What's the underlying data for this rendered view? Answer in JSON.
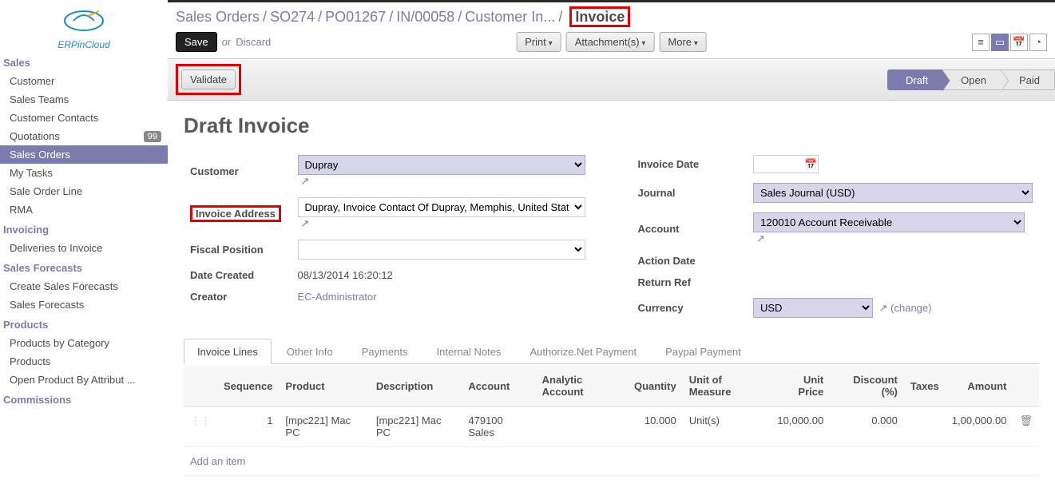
{
  "logo_text": "ERPinCloud",
  "sidebar": {
    "groups": [
      {
        "header": "Sales",
        "items": [
          {
            "label": "Customer"
          },
          {
            "label": "Sales Teams"
          },
          {
            "label": "Customer Contacts"
          },
          {
            "label": "Quotations",
            "badge": "99"
          },
          {
            "label": "Sales Orders",
            "active": true
          },
          {
            "label": "My Tasks"
          },
          {
            "label": "Sale Order Line"
          },
          {
            "label": "RMA"
          }
        ]
      },
      {
        "header": "Invoicing",
        "items": [
          {
            "label": "Deliveries to Invoice"
          }
        ]
      },
      {
        "header": "Sales Forecasts",
        "items": [
          {
            "label": "Create Sales Forecasts"
          },
          {
            "label": "Sales Forecasts"
          }
        ]
      },
      {
        "header": "Products",
        "items": [
          {
            "label": "Products by Category"
          },
          {
            "label": "Products"
          },
          {
            "label": "Open Product By Attribut ..."
          }
        ]
      },
      {
        "header": "Commissions",
        "items": []
      }
    ]
  },
  "breadcrumbs": {
    "items": [
      "Sales Orders",
      "SO274",
      "PO01267",
      "IN/00058",
      "Customer In..."
    ],
    "current": "Invoice"
  },
  "toolbar": {
    "save": "Save",
    "or": "or",
    "discard": "Discard",
    "print": "Print",
    "attachments": "Attachment(s)",
    "more": "More"
  },
  "status": {
    "validate": "Validate",
    "steps": [
      "Draft",
      "Open",
      "Paid"
    ],
    "active": 0
  },
  "title": "Draft Invoice",
  "form": {
    "left": {
      "customer_label": "Customer",
      "customer": "Dupray",
      "addr_label": "Invoice Address",
      "addr": "Dupray, Invoice Contact Of Dupray, Memphis, United State",
      "fiscal_label": "Fiscal Position",
      "fiscal": "",
      "datec_label": "Date Created",
      "datec": "08/13/2014 16:20:12",
      "creator_label": "Creator",
      "creator": "EC-Administrator"
    },
    "right": {
      "invdate_label": "Invoice Date",
      "invdate": "",
      "journal_label": "Journal",
      "journal": "Sales Journal (USD)",
      "account_label": "Account",
      "account": "120010 Account Receivable",
      "actiondate_label": "Action Date",
      "returnref_label": "Return Ref",
      "currency_label": "Currency",
      "currency": "USD",
      "change": "(change)"
    }
  },
  "tabs": [
    "Invoice Lines",
    "Other Info",
    "Payments",
    "Internal Notes",
    "Authorize.Net Payment",
    "Paypal Payment"
  ],
  "lines": {
    "headers": [
      "",
      "Sequence",
      "Product",
      "Description",
      "Account",
      "Analytic Account",
      "Quantity",
      "Unit of Measure",
      "Unit Price",
      "Discount (%)",
      "Taxes",
      "Amount",
      ""
    ],
    "rows": [
      {
        "seq": "1",
        "product": "[mpc221] Mac PC",
        "desc": "[mpc221] Mac PC",
        "account": "479100 Sales",
        "analytic": "",
        "qty": "10.000",
        "uom": "Unit(s)",
        "price": "10,000.00",
        "disc": "0.000",
        "taxes": "",
        "amount": "1,00,000.00"
      }
    ],
    "add": "Add an item"
  }
}
